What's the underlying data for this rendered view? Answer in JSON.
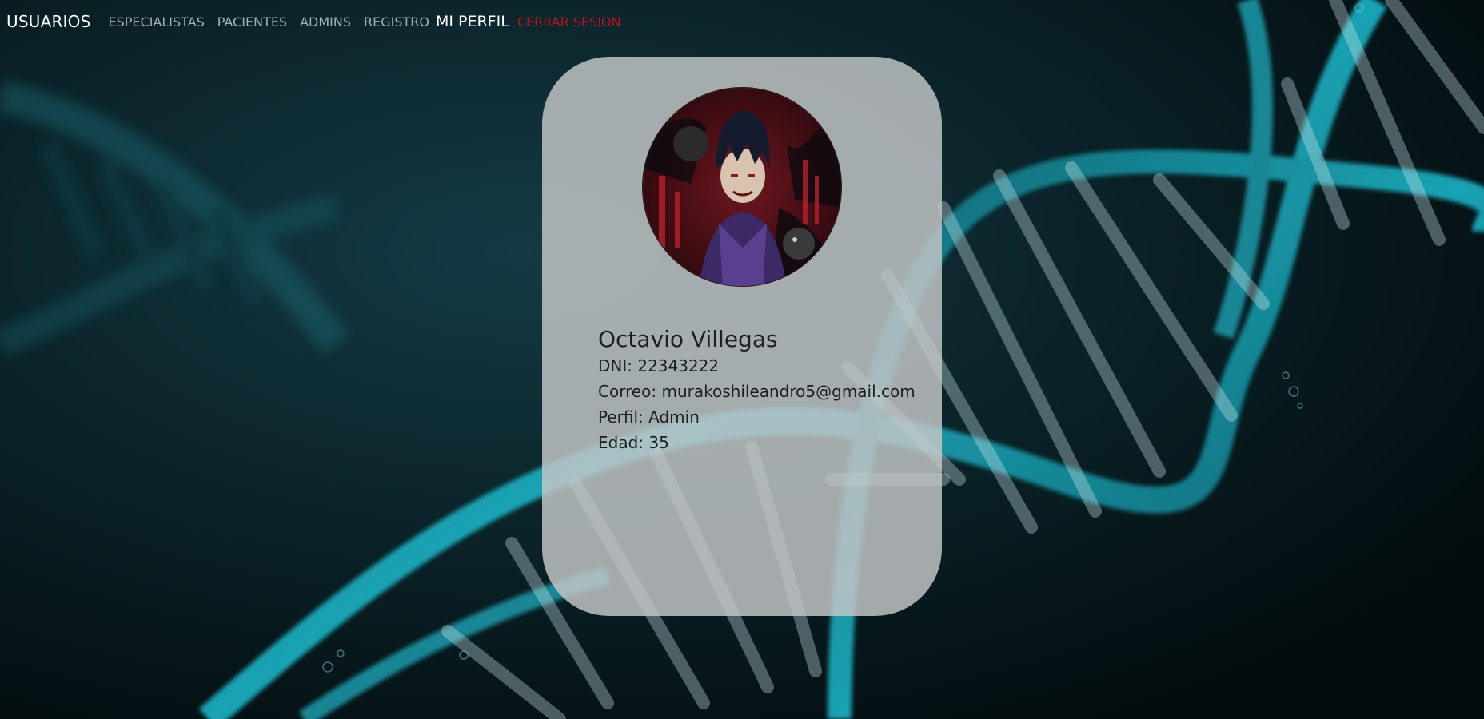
{
  "nav": {
    "brand": "USUARIOS",
    "links": {
      "especialistas": "ESPECIALISTAS",
      "pacientes": "PACIENTES",
      "admins": "ADMINS",
      "registro": "REGISTRO",
      "mi_perfil": "MI PERFIL",
      "cerrar_sesion": "CERRAR SESION"
    }
  },
  "profile": {
    "name": "Octavio Villegas",
    "dni": "DNI: 22343222",
    "correo": "Correo: murakoshileandro5@gmail.com",
    "perfil": "Perfil: Admin",
    "edad": "Edad: 35"
  },
  "colors": {
    "background": "#040d10",
    "dna_cyan": "#19a6b8",
    "card": "#c4c7c8",
    "nav_link": "#a9b0b4",
    "logout": "#b8121d"
  },
  "icons": {
    "avatar": "anime-character-avatar",
    "background": "dna-helix-illustration"
  }
}
